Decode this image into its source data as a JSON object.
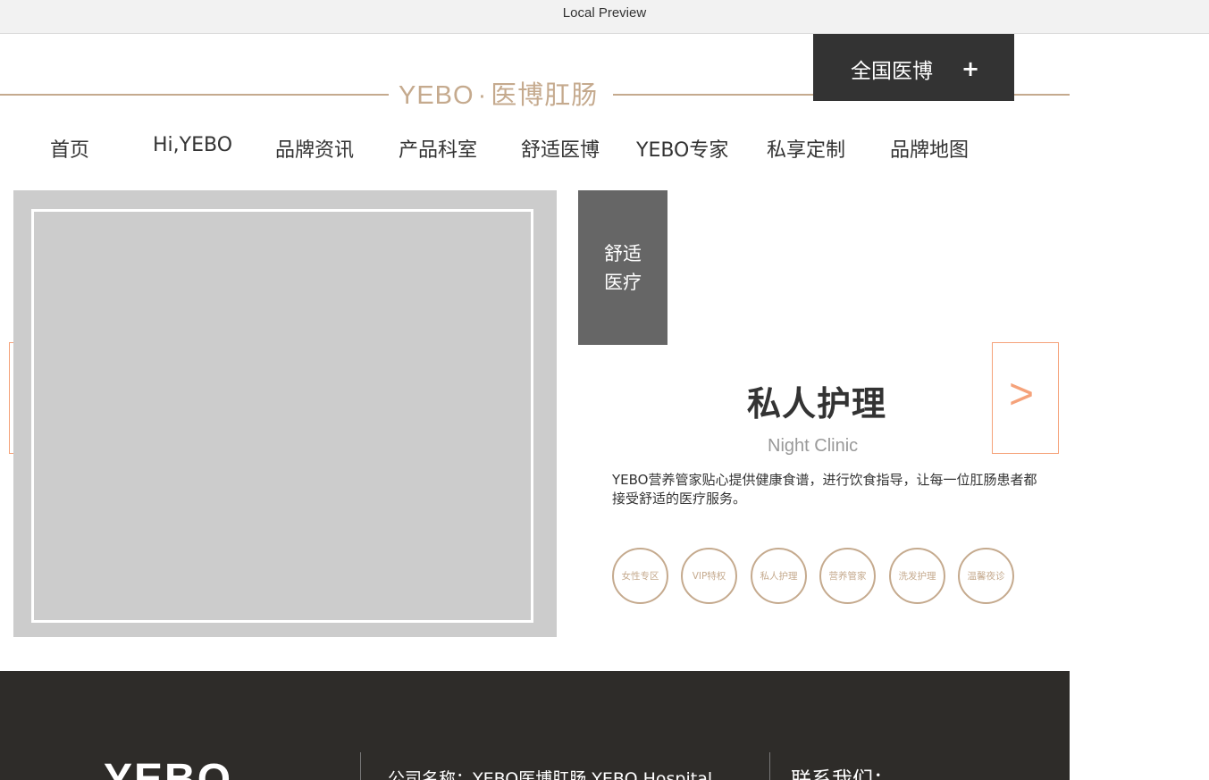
{
  "window": {
    "title": "Local Preview"
  },
  "header": {
    "logo_brand": "YEBO",
    "logo_dot": "·",
    "logo_name": "医博肛肠",
    "national_button": {
      "label": "全国医博",
      "icon": "+"
    }
  },
  "nav": {
    "items": [
      "首页",
      "Hi,YEBO",
      "品牌资讯",
      "产品科室",
      "舒适医博",
      "YEBO专家",
      "私享定制",
      "品牌地图"
    ]
  },
  "main": {
    "category_tab": {
      "line1": "舒适",
      "line2": "医疗"
    },
    "prev_arrow": "<",
    "next_arrow": ">",
    "title": "私人护理",
    "subtitle": "Night Clinic",
    "description": "YEBO营养管家贴心提供健康食谱，进行饮食指导，让每一位肛肠患者都接受舒适的医疗服务。",
    "tags": [
      "女性专区",
      "VIP特权",
      "私人护理",
      "营养管家",
      "洗发护理",
      "温馨夜诊"
    ]
  },
  "footer": {
    "logo": "YEBO",
    "company": "公司名称：YEBO医博肛肠 YEBO Hospital",
    "contact": "联系我们："
  },
  "colors": {
    "accent_gold": "#c5aa8e",
    "arrow_orange": "#f5a27a",
    "dark": "#333333",
    "footer_bg": "#2e2c29",
    "placeholder_gray": "#cccccc"
  }
}
